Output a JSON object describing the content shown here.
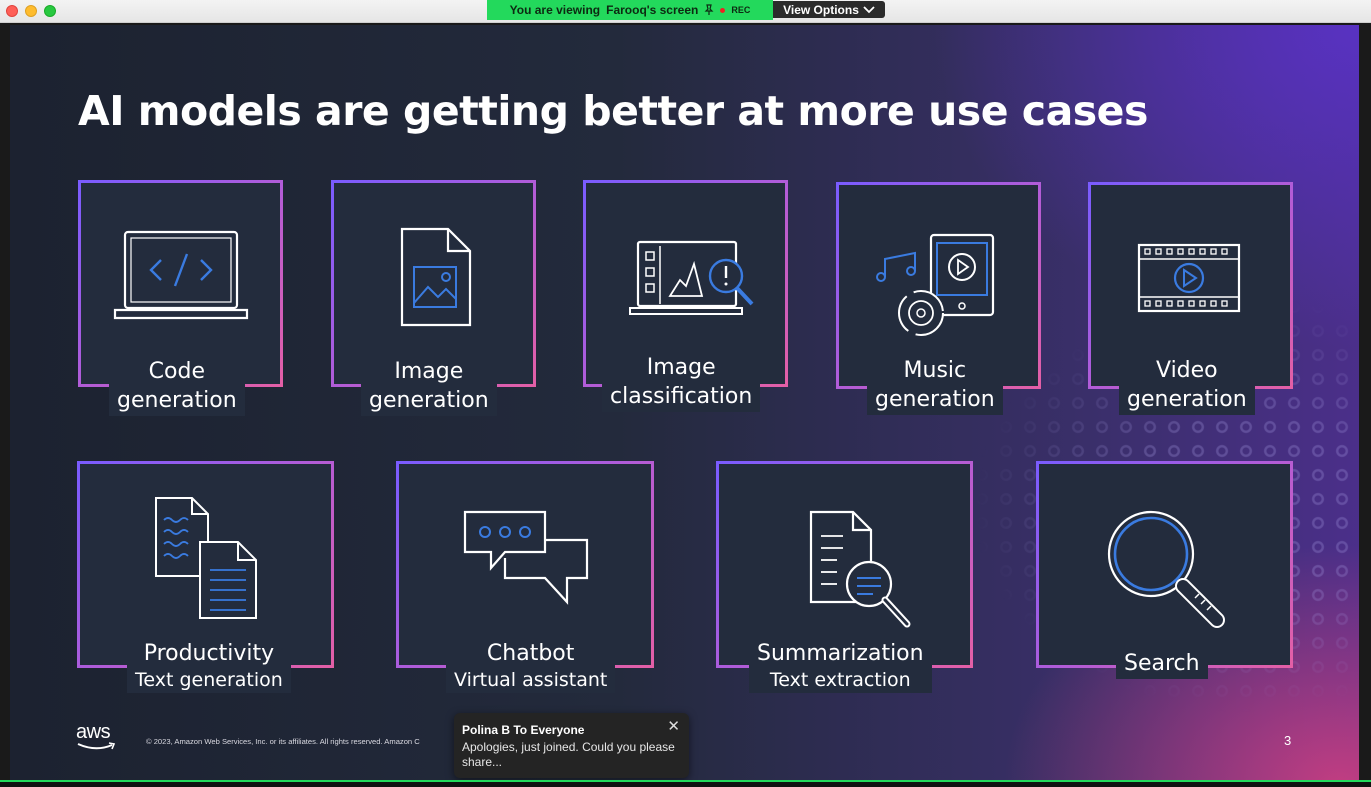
{
  "window": {
    "viewing_prefix": "You are viewing",
    "viewing_name": "Farooq's screen",
    "rec_label": "REC",
    "view_options_label": "View Options"
  },
  "slide": {
    "title": "AI models are getting better at more use cases",
    "cards": [
      {
        "line1": "Code",
        "line2": "generation",
        "icon": "laptop-code-icon"
      },
      {
        "line1": "Image",
        "line2": "generation",
        "icon": "image-file-icon"
      },
      {
        "line1": "Image",
        "line2": "classification",
        "icon": "image-classification-icon"
      },
      {
        "line1": "Music",
        "line2": "generation",
        "icon": "music-generation-icon"
      },
      {
        "line1": "Video",
        "line2": "generation",
        "icon": "video-film-icon"
      },
      {
        "line1": "Productivity",
        "line2": "Text generation",
        "icon": "documents-icon"
      },
      {
        "line1": "Chatbot",
        "line2": "Virtual assistant",
        "icon": "chat-bubbles-icon"
      },
      {
        "line1": "Summarization",
        "line2": "Text extraction",
        "icon": "document-search-icon"
      },
      {
        "line1": "Search",
        "line2": "",
        "icon": "magnifier-icon"
      }
    ],
    "logo_text": "aws",
    "copyright": "© 2023, Amazon Web Services, Inc. or its affiliates. All rights reserved. Amazon C",
    "page_number": "3"
  },
  "chat": {
    "sender": "Polina B To Everyone",
    "message": "Apologies, just joined. Could you please share...",
    "close_symbol": "✕"
  },
  "colors": {
    "accent_blue": "#2f6fd6",
    "card_border_start": "#7a5cff",
    "card_border_end": "#e35fa6",
    "banner_green": "#23d95c"
  }
}
